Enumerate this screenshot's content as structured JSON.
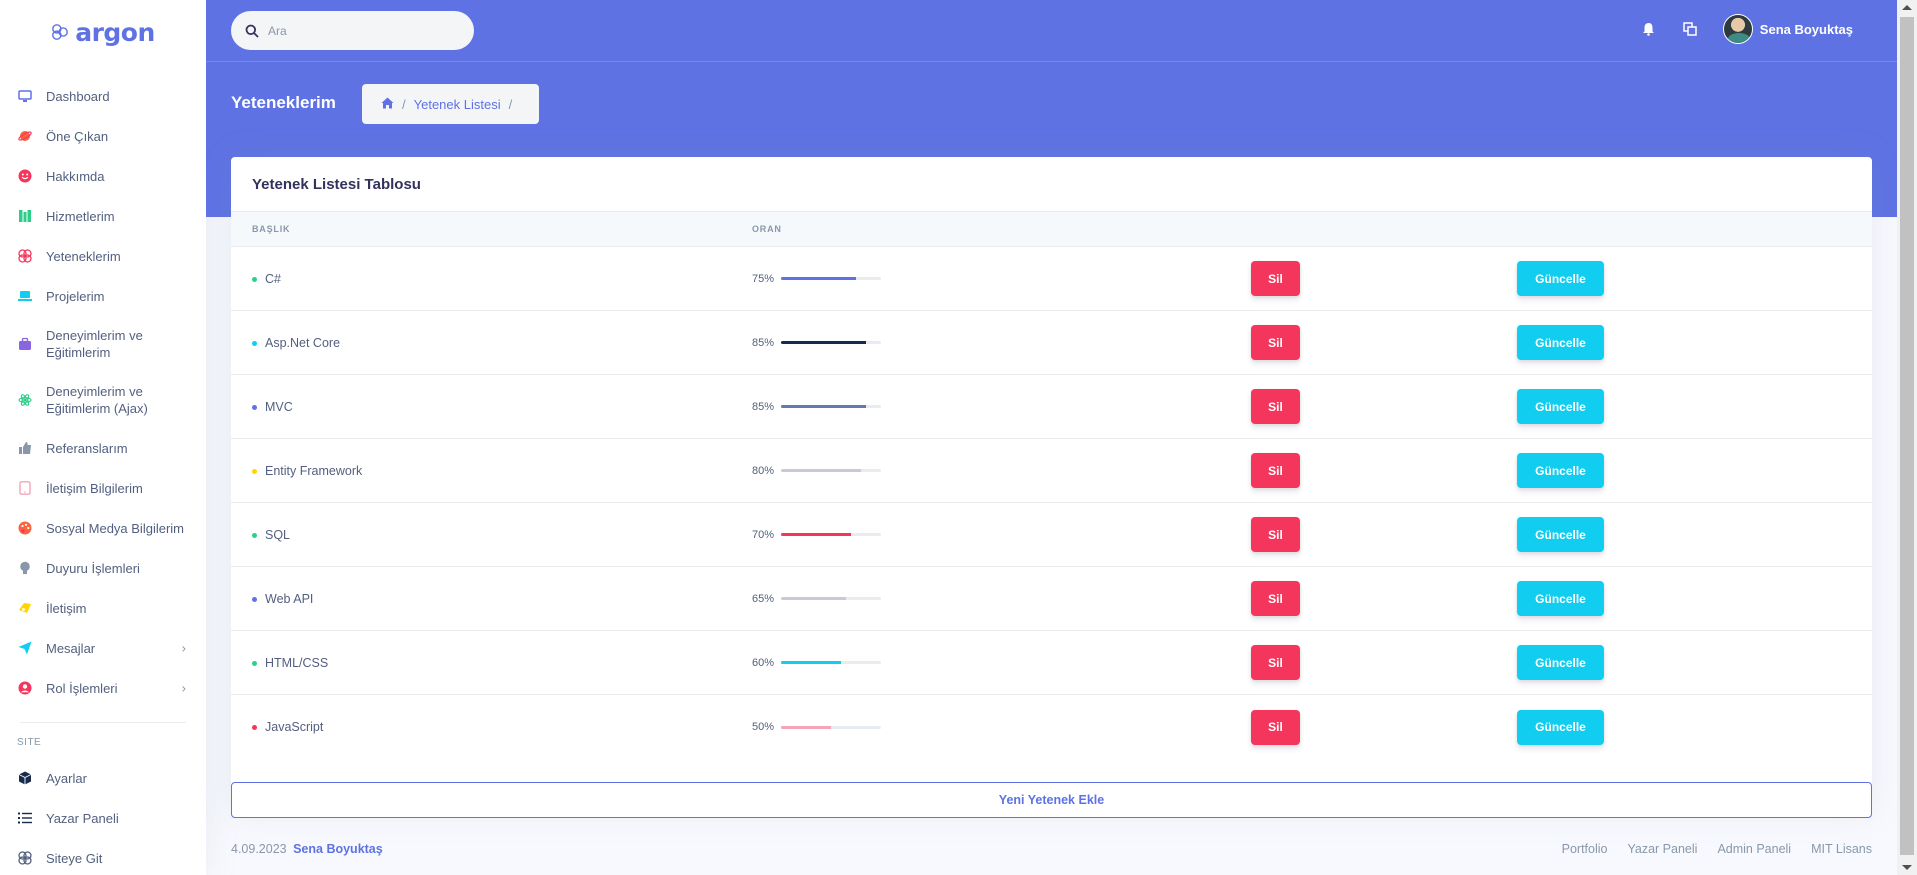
{
  "brand": {
    "name": "argon"
  },
  "sidebar": {
    "items": [
      {
        "label": "Dashboard",
        "icon": "monitor-icon",
        "color": "#5e72e4"
      },
      {
        "label": "Öne Çıkan",
        "icon": "planet-icon",
        "color": "#fb6340"
      },
      {
        "label": "Hakkımda",
        "icon": "smile-icon",
        "color": "#f5365c"
      },
      {
        "label": "Hizmetlerim",
        "icon": "books-icon",
        "color": "#2dce89"
      },
      {
        "label": "Yeteneklerim",
        "icon": "atom-icon",
        "color": "#f5365c"
      },
      {
        "label": "Projelerim",
        "icon": "laptop-icon",
        "color": "#11cdef"
      },
      {
        "label": "Deneyimlerim ve Eğitimlerim",
        "icon": "briefcase-icon",
        "color": "#8965e0"
      },
      {
        "label": "Deneyimlerim ve Eğitimlerim (Ajax)",
        "icon": "atom-icon",
        "color": "#2dce89"
      },
      {
        "label": "Referanslarım",
        "icon": "thumbs-up-icon",
        "color": "#8898aa"
      },
      {
        "label": "İletişim Bilgilerim",
        "icon": "tablet-icon",
        "color": "#f3a4b5"
      },
      {
        "label": "Sosyal Medya Bilgilerim",
        "icon": "palette-icon",
        "color": "#fb6340"
      },
      {
        "label": "Duyuru İşlemleri",
        "icon": "bulb-icon",
        "color": "#8898aa"
      },
      {
        "label": "İletişim",
        "icon": "glasses-icon",
        "color": "#ffd600"
      },
      {
        "label": "Mesajlar",
        "icon": "send-icon",
        "color": "#11cdef"
      },
      {
        "label": "Rol İşlemleri",
        "icon": "user-circle-icon",
        "color": "#f5365c"
      }
    ],
    "section_label": "SITE",
    "site_items": [
      {
        "label": "Ayarlar",
        "icon": "box-icon",
        "color": "#172b4d"
      },
      {
        "label": "Yazar Paneli",
        "icon": "list-icon",
        "color": "#172b4d"
      },
      {
        "label": "Siteye Git",
        "icon": "atom-icon",
        "color": "#525f7f"
      }
    ]
  },
  "search": {
    "placeholder": "Ara"
  },
  "user": {
    "name": "Sena Boyuktaş"
  },
  "page": {
    "title": "Yeteneklerim",
    "breadcrumb": [
      "Yetenek Listesi"
    ]
  },
  "card": {
    "title": "Yetenek Listesi Tablosu",
    "columns": [
      "BAŞLIK",
      "ORAN"
    ],
    "rows": [
      {
        "name": "C#",
        "rate": "75%",
        "value": 75,
        "color": "#5e72e4",
        "dot": "#2dce89",
        "delete": "Sil",
        "update": "Güncelle"
      },
      {
        "name": "Asp.Net Core",
        "rate": "85%",
        "value": 85,
        "color": "#172b4d",
        "dot": "#11cdef",
        "delete": "Sil",
        "update": "Güncelle"
      },
      {
        "name": "MVC",
        "rate": "85%",
        "value": 85,
        "color": "#6178b0",
        "dot": "#5e72e4",
        "delete": "Sil",
        "update": "Güncelle"
      },
      {
        "name": "Entity Framework",
        "rate": "80%",
        "value": 80,
        "color": "#c8cbd3",
        "dot": "#ffd600",
        "delete": "Sil",
        "update": "Güncelle"
      },
      {
        "name": "SQL",
        "rate": "70%",
        "value": 70,
        "color": "#f5365c",
        "dot": "#2dce89",
        "delete": "Sil",
        "update": "Güncelle"
      },
      {
        "name": "Web API",
        "rate": "65%",
        "value": 65,
        "color": "#c8cbd3",
        "dot": "#5e72e4",
        "delete": "Sil",
        "update": "Güncelle"
      },
      {
        "name": "HTML/CSS",
        "rate": "60%",
        "value": 60,
        "color": "#11cdef",
        "dot": "#2dce89",
        "delete": "Sil",
        "update": "Güncelle"
      },
      {
        "name": "JavaScript",
        "rate": "50%",
        "value": 50,
        "color": "#f3a4b5",
        "dot": "#f5365c",
        "delete": "Sil",
        "update": "Güncelle"
      }
    ],
    "add_button": "Yeni Yetenek Ekle"
  },
  "footer": {
    "date": "4.09.2023",
    "author": "Sena Boyuktaş",
    "links": [
      "Portfolio",
      "Yazar Paneli",
      "Admin Paneli",
      "MIT Lisans"
    ]
  }
}
